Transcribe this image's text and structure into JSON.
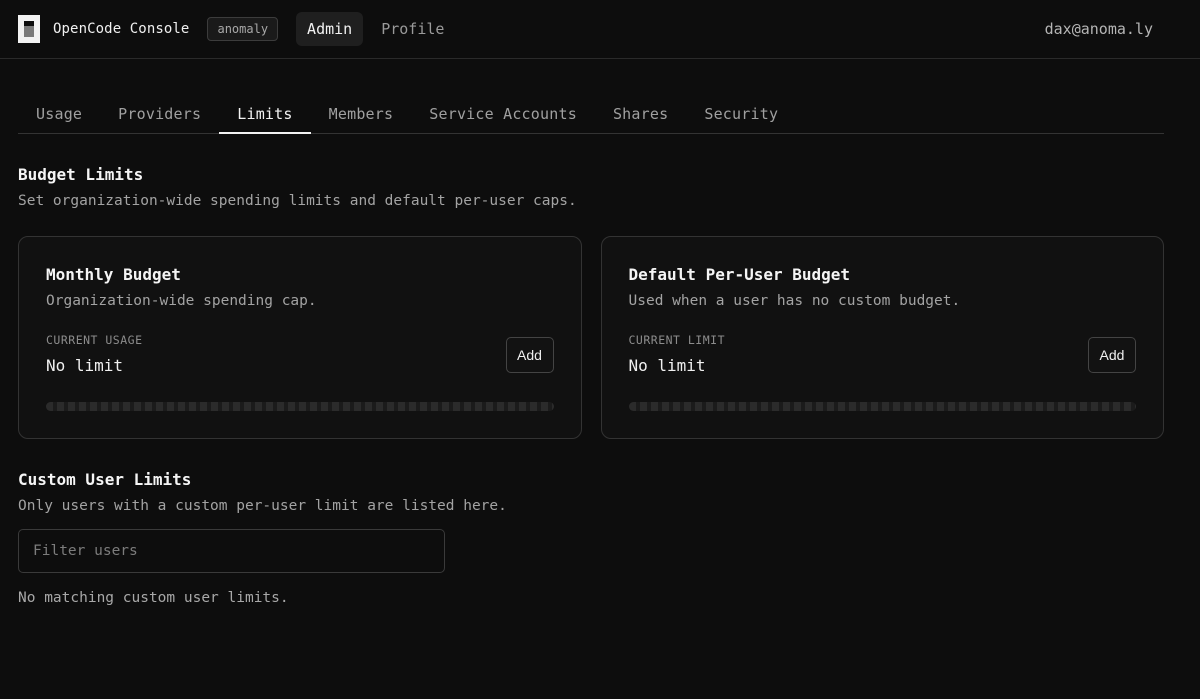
{
  "topbar": {
    "brand": "OpenCode Console",
    "org_badge": "anomaly",
    "nav": [
      {
        "label": "Admin",
        "active": true
      },
      {
        "label": "Profile",
        "active": false
      }
    ],
    "user_email": "dax@anoma.ly"
  },
  "tabs": [
    {
      "label": "Usage",
      "active": false
    },
    {
      "label": "Providers",
      "active": false
    },
    {
      "label": "Limits",
      "active": true
    },
    {
      "label": "Members",
      "active": false
    },
    {
      "label": "Service Accounts",
      "active": false
    },
    {
      "label": "Shares",
      "active": false
    },
    {
      "label": "Security",
      "active": false
    }
  ],
  "budget_limits": {
    "title": "Budget Limits",
    "description": "Set organization-wide spending limits and default per-user caps.",
    "cards": [
      {
        "title": "Monthly Budget",
        "description": "Organization-wide spending cap.",
        "meta_label": "CURRENT USAGE",
        "meta_value": "No limit",
        "button_label": "Add"
      },
      {
        "title": "Default Per-User Budget",
        "description": "Used when a user has no custom budget.",
        "meta_label": "CURRENT LIMIT",
        "meta_value": "No limit",
        "button_label": "Add"
      }
    ]
  },
  "custom_limits": {
    "title": "Custom User Limits",
    "description": "Only users with a custom per-user limit are listed here.",
    "filter_placeholder": "Filter users",
    "filter_value": "",
    "empty_message": "No matching custom user limits."
  },
  "colors": {
    "background": "#0d0d0d",
    "border": "#333333",
    "text_primary": "#f2f2f2",
    "text_muted": "#a3a3a3"
  }
}
